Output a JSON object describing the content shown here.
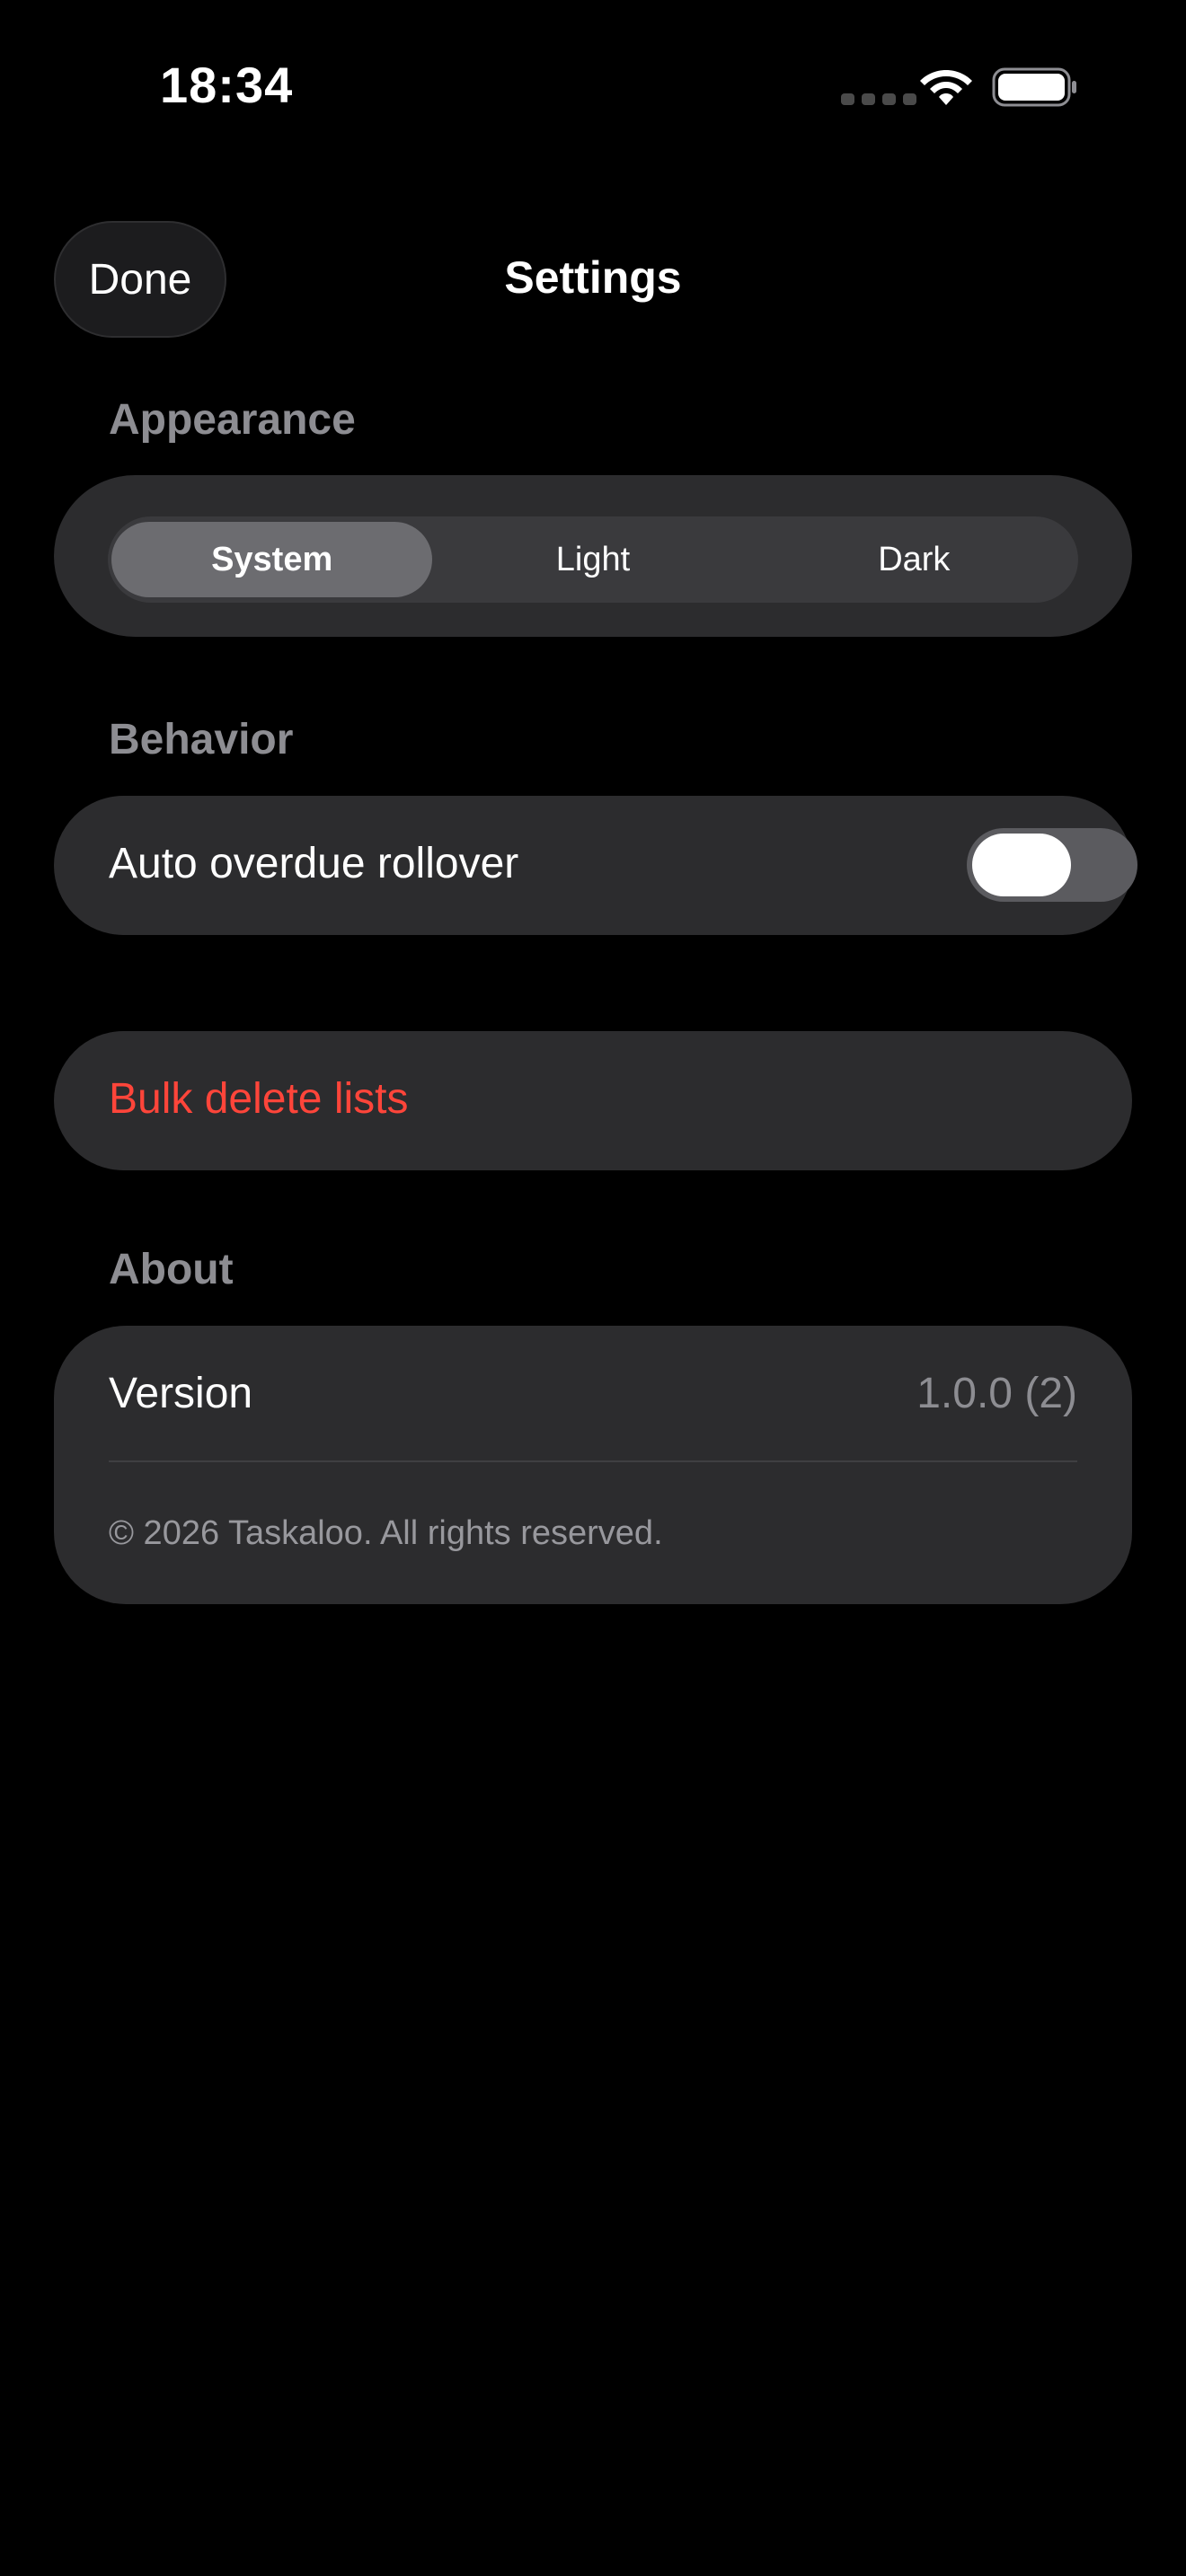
{
  "status_bar": {
    "time": "18:34",
    "icons": [
      "cellular-signal-icon",
      "wifi-icon",
      "battery-icon"
    ]
  },
  "nav": {
    "done_label": "Done",
    "title": "Settings"
  },
  "appearance": {
    "header": "Appearance",
    "options": [
      "System",
      "Light",
      "Dark"
    ],
    "selected": "System"
  },
  "behavior": {
    "header": "Behavior",
    "auto_overdue_rollover_label": "Auto overdue rollover",
    "auto_overdue_rollover_on": false
  },
  "actions": {
    "bulk_delete_label": "Bulk delete lists"
  },
  "about": {
    "header": "About",
    "version_label": "Version",
    "version_value": "1.0.0 (2)",
    "copyright": "© 2026 Taskaloo. All rights reserved."
  },
  "colors": {
    "background": "#000000",
    "card": "#2c2c2e",
    "section_header": "#8d8d92",
    "destructive": "#ff453a",
    "segment_selected": "#6c6c70"
  }
}
